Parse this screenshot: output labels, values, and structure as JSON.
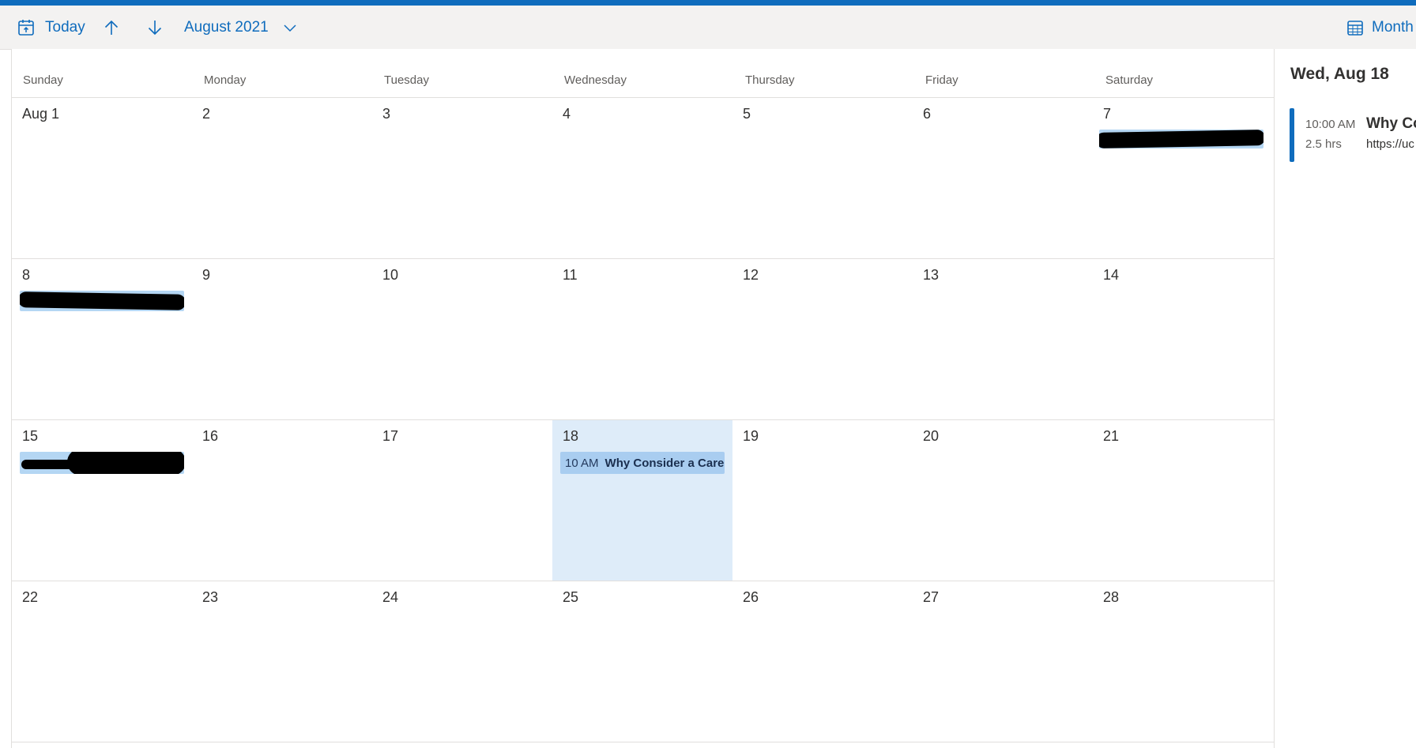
{
  "toolbar": {
    "today_label": "Today",
    "month_year": "August 2021",
    "view_label": "Month"
  },
  "weekdays": [
    "Sunday",
    "Monday",
    "Tuesday",
    "Wednesday",
    "Thursday",
    "Friday",
    "Saturday"
  ],
  "weeks": [
    [
      "Aug 1",
      "2",
      "3",
      "4",
      "5",
      "6",
      "7"
    ],
    [
      "8",
      "9",
      "10",
      "11",
      "12",
      "13",
      "14"
    ],
    [
      "15",
      "16",
      "17",
      "18",
      "19",
      "20",
      "21"
    ],
    [
      "22",
      "23",
      "24",
      "25",
      "26",
      "27",
      "28"
    ]
  ],
  "selected_event": {
    "time": "10 AM",
    "title": "Why Consider a Caree"
  },
  "side_panel": {
    "date_heading": "Wed, Aug 18",
    "event_time": "10:00 AM",
    "event_duration": "2.5 hrs",
    "event_title": "Why Co",
    "event_link": "https://uc"
  },
  "colors": {
    "accent": "#0f6cbd",
    "selected_day_bg": "#deecf9",
    "event_bg": "#b4d6f3"
  },
  "icons": {
    "today": "calendar-today-icon",
    "previous": "arrow-up-icon",
    "next": "arrow-down-icon",
    "month_picker": "chevron-down-icon",
    "view": "calendar-month-icon"
  }
}
